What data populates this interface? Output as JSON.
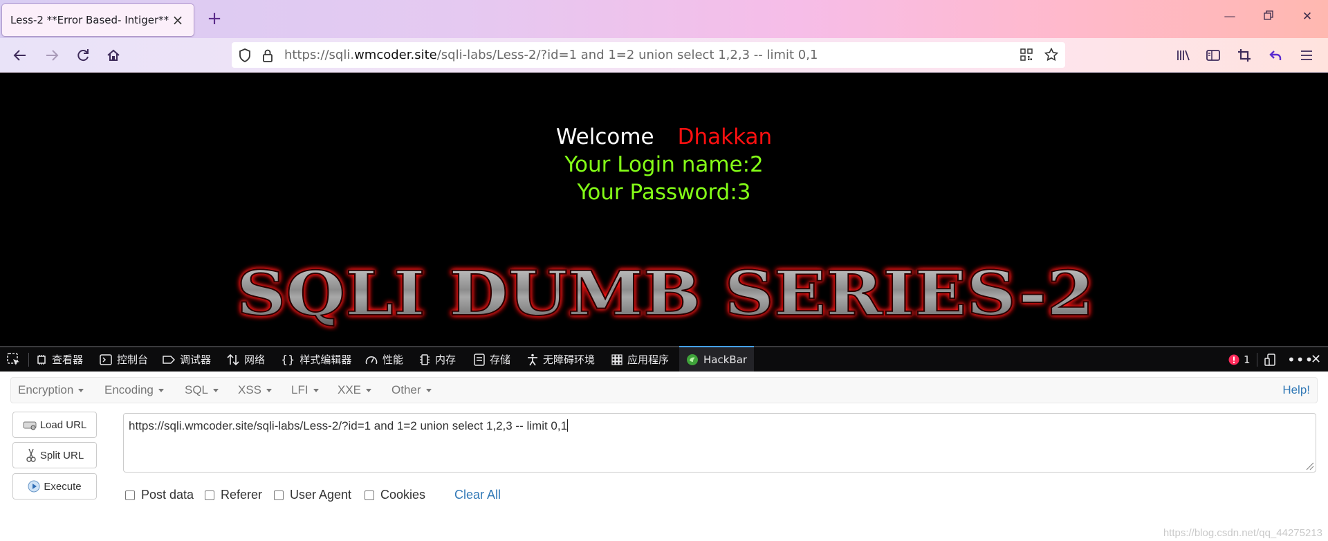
{
  "browser": {
    "tab_title": "Less-2 **Error Based- Intiger**",
    "url_prefix": "https://sqli.",
    "url_domain": "wmcoder.site",
    "url_path": "/sqli-labs/Less-2/?id=1 and 1=2 union select 1,2,3 -- limit 0,1"
  },
  "page": {
    "welcome_label": "Welcome",
    "welcome_name": "Dhakkan",
    "login_line": "Your Login name:2",
    "password_line": "Your Password:3",
    "banner_text": "SQLI DUMB SERIES-2"
  },
  "devtools": {
    "tabs": [
      "查看器",
      "控制台",
      "调试器",
      "网络",
      "样式编辑器",
      "性能",
      "内存",
      "存储",
      "无障碍环境",
      "应用程序",
      "HackBar"
    ],
    "error_count": "1"
  },
  "hackbar": {
    "menu": [
      "Encryption",
      "Encoding",
      "SQL",
      "XSS",
      "LFI",
      "XXE",
      "Other"
    ],
    "help": "Help!",
    "buttons": {
      "load": "Load URL",
      "split": "Split URL",
      "execute": "Execute"
    },
    "url_value": "https://sqli.wmcoder.site/sqli-labs/Less-2/?id=1 and 1=2 union select 1,2,3 -- limit 0,1",
    "options": [
      "Post data",
      "Referer",
      "User Agent",
      "Cookies"
    ],
    "clear_all": "Clear All"
  },
  "watermark": "https://blog.csdn.net/qq_44275213",
  "colors": {
    "page_bg": "#000000",
    "welcome_name": "#ff1010",
    "green_text": "#84ff17",
    "link_blue": "#337ab7",
    "devtools_bg": "#0c0c0d",
    "active_tab_accent": "#45a1ff"
  }
}
